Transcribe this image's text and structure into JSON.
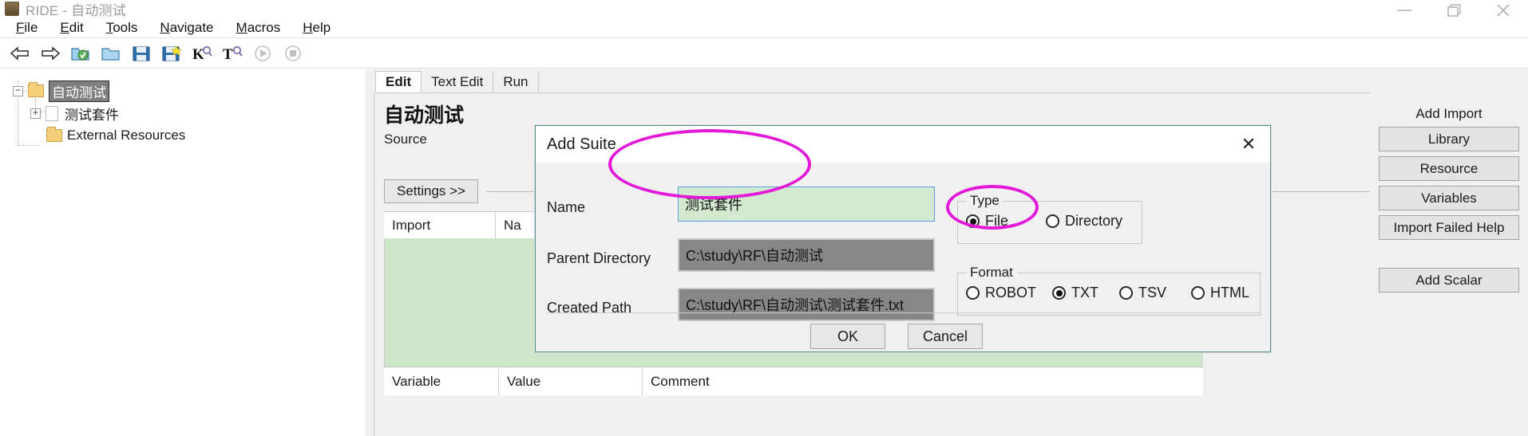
{
  "window": {
    "title": "RIDE - 自动测试",
    "controls": {
      "minimize": "—",
      "restore": "❐",
      "close": "✕"
    }
  },
  "menubar": {
    "items": [
      {
        "label": "File",
        "accel": "F"
      },
      {
        "label": "Edit",
        "accel": "E"
      },
      {
        "label": "Tools",
        "accel": "T"
      },
      {
        "label": "Navigate",
        "accel": "N"
      },
      {
        "label": "Macros",
        "accel": "M"
      },
      {
        "label": "Help",
        "accel": "H"
      }
    ]
  },
  "toolbar": {
    "items": [
      {
        "name": "back-arrow-icon",
        "title": "Back"
      },
      {
        "name": "forward-arrow-icon",
        "title": "Forward"
      },
      {
        "name": "open-project-icon",
        "title": "Open Directory"
      },
      {
        "name": "open-folder-icon",
        "title": "Open"
      },
      {
        "name": "save-icon",
        "title": "Save"
      },
      {
        "name": "save-all-icon",
        "title": "Save All"
      },
      {
        "name": "search-keyword-icon",
        "title": "Search Keywords"
      },
      {
        "name": "search-test-icon",
        "title": "Search Tests"
      },
      {
        "name": "run-icon",
        "title": "Run"
      },
      {
        "name": "stop-icon",
        "title": "Stop"
      }
    ]
  },
  "tree": {
    "root": {
      "label": "自动测试",
      "selected": true,
      "expander": "-"
    },
    "child": {
      "label": "测试套件",
      "expander": "+"
    },
    "external": {
      "label": "External Resources"
    }
  },
  "editor": {
    "tabs": [
      {
        "label": "Edit",
        "active": true
      },
      {
        "label": "Text Edit",
        "active": false
      },
      {
        "label": "Run",
        "active": false
      }
    ],
    "tabnav": {
      "prev": "◁",
      "next": "▷",
      "close": "✕"
    },
    "suite_title": "自动测试",
    "source_label": "Source",
    "settings_button": "Settings >>",
    "import_table": {
      "headers": [
        "Import",
        "Na"
      ]
    },
    "variable_table": {
      "headers": [
        "Variable",
        "Value",
        "Comment"
      ]
    }
  },
  "right_panel": {
    "add_import_title": "Add Import",
    "buttons": [
      "Library",
      "Resource",
      "Variables",
      "Import Failed Help"
    ],
    "add_scalar": "Add Scalar"
  },
  "dialog": {
    "title": "Add Suite",
    "close_icon": "✕",
    "fields": {
      "name_label": "Name",
      "name_value": "测试套件",
      "parent_label": "Parent Directory",
      "parent_value": "C:\\study\\RF\\自动测试",
      "created_label": "Created Path",
      "created_value": "C:\\study\\RF\\自动测试\\测试套件.txt"
    },
    "type_group": {
      "legend": "Type",
      "options": [
        {
          "label": "File",
          "selected": true
        },
        {
          "label": "Directory",
          "selected": false
        }
      ]
    },
    "format_group": {
      "legend": "Format",
      "options": [
        {
          "label": "ROBOT",
          "selected": false
        },
        {
          "label": "TXT",
          "selected": true
        },
        {
          "label": "TSV",
          "selected": false
        },
        {
          "label": "HTML",
          "selected": false
        }
      ]
    },
    "ok_button": "OK",
    "cancel_button": "Cancel"
  },
  "annotations": {
    "color": "#e318d8",
    "ellipses": [
      {
        "name": "name-field-highlight"
      },
      {
        "name": "file-radio-highlight"
      }
    ]
  }
}
